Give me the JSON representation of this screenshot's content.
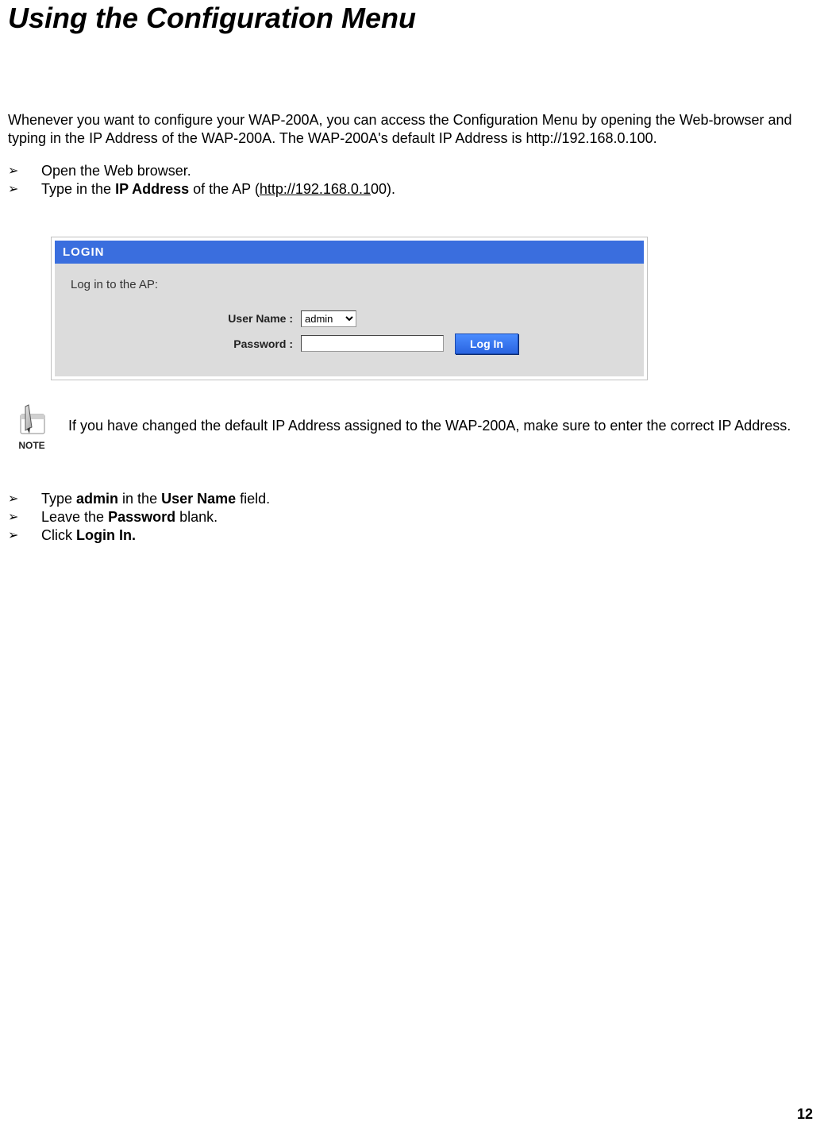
{
  "title": "Using the Configuration Menu",
  "intro": "Whenever you want to configure your WAP-200A, you can access the Configuration Menu by opening the Web-browser and typing in the IP Address of the WAP-200A. The WAP-200A's default IP Address is http://192.168.0.100.",
  "bullets_top": {
    "b1": "Open the Web browser.",
    "b2_prefix": "Type in the ",
    "b2_bold": "IP Address",
    "b2_mid": " of the AP (",
    "b2_link": "http://192.168.0.1",
    "b2_suffix": "00)."
  },
  "login": {
    "header": "LOGIN",
    "subtitle": "Log in to the AP:",
    "username_label": "User Name :",
    "username_value": "admin",
    "password_label": "Password :",
    "password_value": "",
    "button": "Log In"
  },
  "note": {
    "label": "NOTE",
    "text": "If you have changed the default IP Address assigned to the WAP-200A, make sure to enter the correct IP Address."
  },
  "bullets_bottom": {
    "b1_prefix": "Type ",
    "b1_bold1": "admin",
    "b1_mid": " in the ",
    "b1_bold2": "User Name",
    "b1_suffix": " field.",
    "b2_prefix": "Leave the ",
    "b2_bold": "Password",
    "b2_suffix": " blank.",
    "b3_prefix": "Click ",
    "b3_bold": "Login In."
  },
  "page_number": "12",
  "glyphs": {
    "arrow": "➢"
  }
}
